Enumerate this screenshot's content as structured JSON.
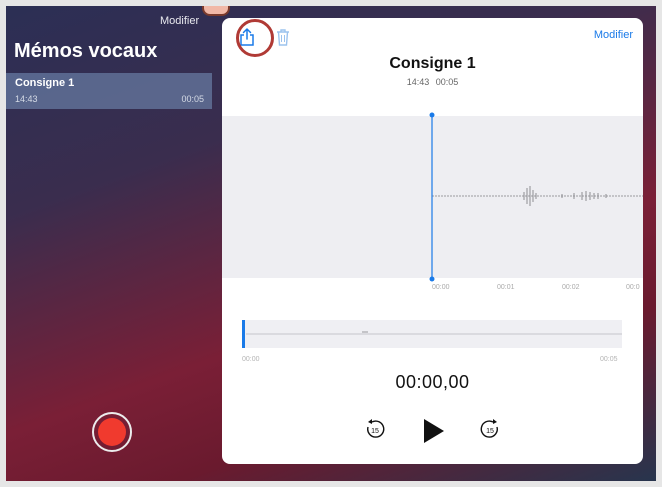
{
  "sidebar": {
    "modifier_label": "Modifier",
    "title": "Mémos vocaux",
    "memos": [
      {
        "name": "Consigne 1",
        "time": "14:43",
        "duration": "00:05"
      }
    ]
  },
  "detail": {
    "modifier_label": "Modifier",
    "title": "Consigne 1",
    "meta_time": "14:43",
    "meta_duration": "00:05",
    "ticks": [
      "00:00",
      "00:01",
      "00:02",
      "00:0"
    ],
    "overview_start": "00:00",
    "overview_end": "00:05",
    "timer": "00:00,00",
    "skip_back_label": "15",
    "skip_forward_label": "15"
  },
  "icons": {
    "share": "share-icon",
    "trash": "trash-icon",
    "record": "record-icon",
    "play": "play-icon",
    "skip_back": "skip-back-15-icon",
    "skip_forward": "skip-forward-15-icon",
    "cursor": "hand-cursor-icon"
  },
  "colors": {
    "accent": "#1a7ae8",
    "record": "#f03a2e",
    "highlight_ring": "#b03a35",
    "selected_row": "#7896be"
  }
}
